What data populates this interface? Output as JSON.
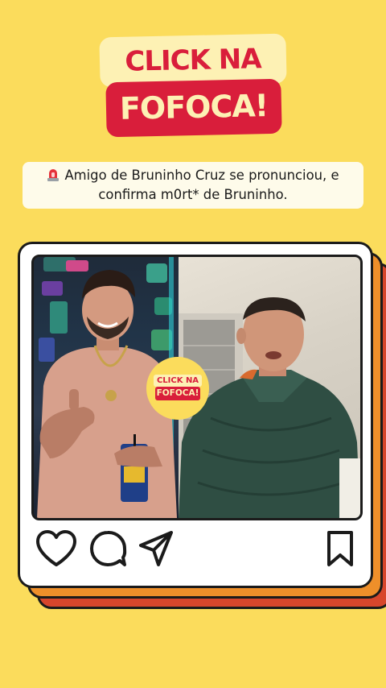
{
  "logo": {
    "line1": "CLICK NA",
    "line2": "FOFOCA!"
  },
  "headline": {
    "icon": "siren-icon",
    "text": "Amigo de Bruninho Cruz se pronunciou, e confirma m0rt* de Bruninho."
  },
  "post": {
    "badge": {
      "line1": "CLICK NA",
      "line2": "FOFOCA!"
    },
    "actions": {
      "like": "heart-icon",
      "comment": "comment-icon",
      "share": "send-icon",
      "save": "bookmark-icon"
    }
  },
  "colors": {
    "background": "#fbdc5c",
    "brand_red": "#d91e3b",
    "brand_cream": "#fdf1b4",
    "card_orange": "#ee8f2a",
    "card_red": "#d7462c"
  }
}
